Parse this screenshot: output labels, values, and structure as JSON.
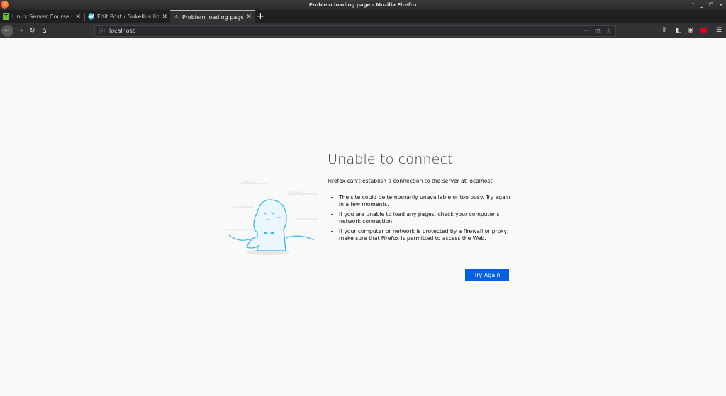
{
  "window": {
    "title": "Problem loading page - Mozilla Firefox",
    "controls": [
      "↑",
      "_",
      "❐",
      "✕"
    ]
  },
  "tabs": [
    {
      "label": "Linux Server Course - Lin",
      "favicon": "T",
      "favicon_color": "#6fbf3b",
      "active": false
    },
    {
      "label": "Edit Post ‹ Sukellus linux",
      "favicon": "W",
      "favicon_color": "#21a0d2",
      "active": false
    },
    {
      "label": "Problem loading page",
      "favicon": "⚠",
      "active": true
    }
  ],
  "new_tab": "+",
  "nav": {
    "url": "localhost",
    "page_actions": "···"
  },
  "error": {
    "title": "Unable to connect",
    "description": "Firefox can’t establish a connection to the server at localhost.",
    "bullets": [
      "The site could be temporarily unavailable or too busy. Try again in a few moments.",
      "If you are unable to load any pages, check your computer’s network connection.",
      "If your computer or network is protected by a firewall or proxy, make sure that Firefox is permitted to access the Web."
    ],
    "button": "Try Again"
  },
  "colors": {
    "accent": "#0060df",
    "illustration": "#35b6f5"
  }
}
